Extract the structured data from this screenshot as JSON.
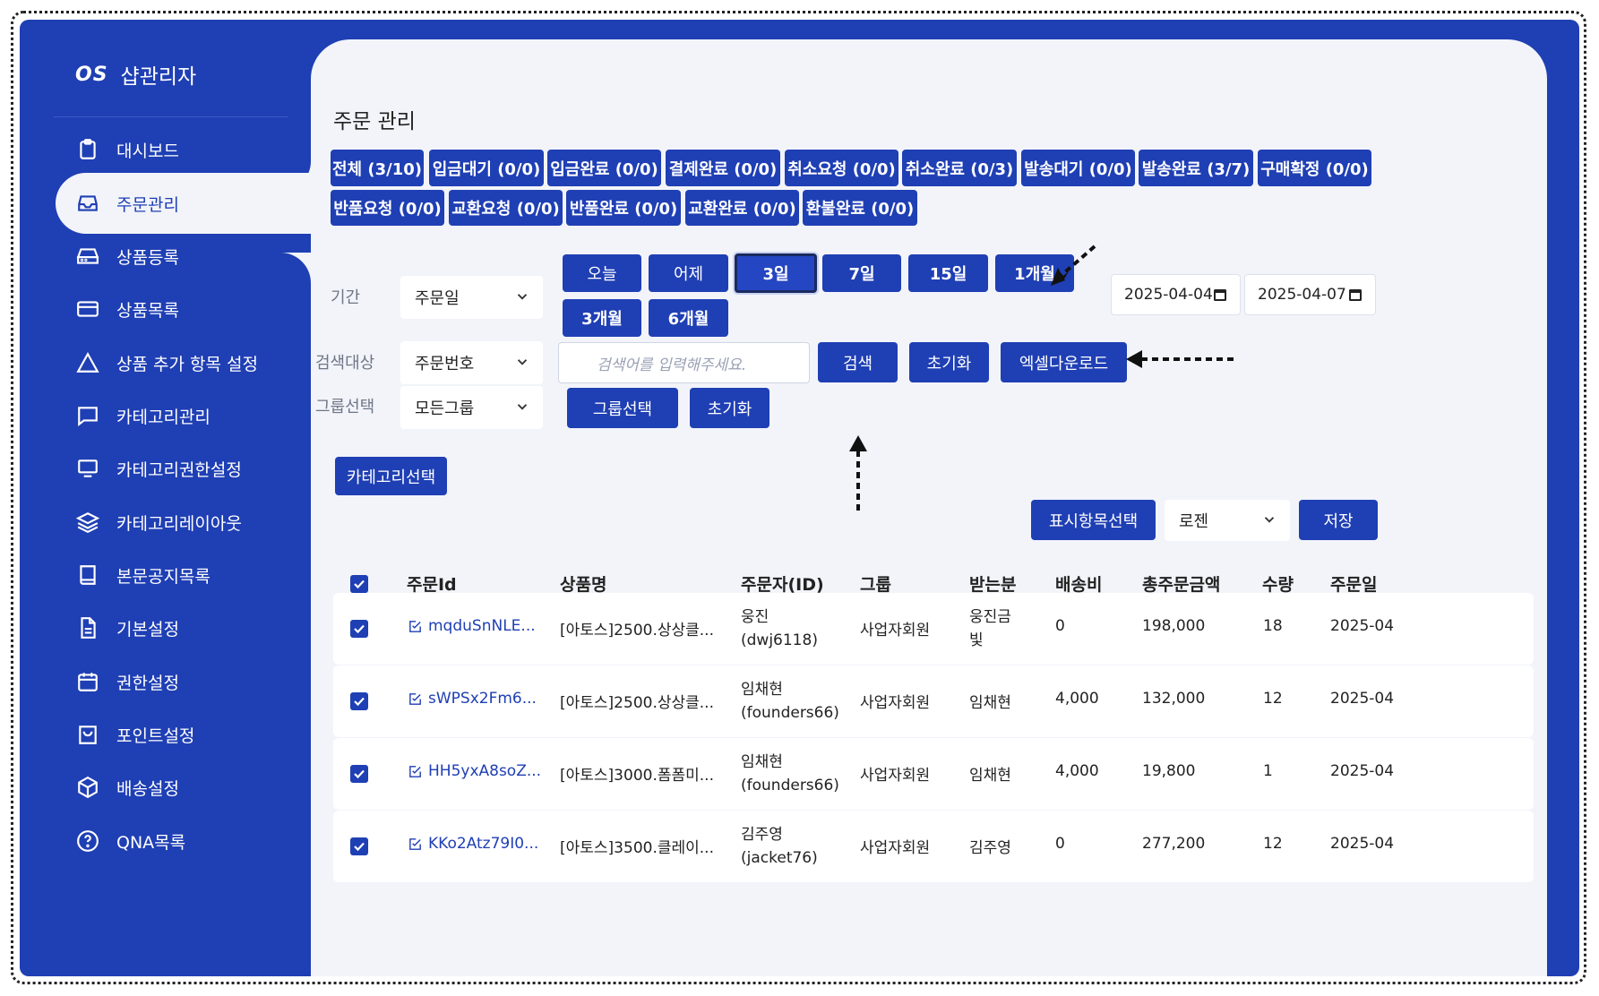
{
  "brand": {
    "logo": "OS",
    "name": "샵관리자"
  },
  "sidebar": {
    "items": [
      {
        "label": "대시보드",
        "icon": "clipboard-icon"
      },
      {
        "label": "주문관리",
        "icon": "inbox-icon",
        "active": true
      },
      {
        "label": "상품등록",
        "icon": "hard-drive-icon"
      },
      {
        "label": "상품목록",
        "icon": "credit-card-icon"
      },
      {
        "label": "상품 추가 항목 설정",
        "icon": "triangle-icon"
      },
      {
        "label": "카테고리관리",
        "icon": "message-square-icon"
      },
      {
        "label": "카테고리권한설정",
        "icon": "monitor-icon"
      },
      {
        "label": "카테고리레이아웃",
        "icon": "layers-icon"
      },
      {
        "label": "본문공지목록",
        "icon": "book-icon"
      },
      {
        "label": "기본설정",
        "icon": "file-text-icon"
      },
      {
        "label": "권한설정",
        "icon": "calendar-icon"
      },
      {
        "label": "포인트설정",
        "icon": "shopping-bag-icon"
      },
      {
        "label": "배송설정",
        "icon": "package-icon"
      },
      {
        "label": "QNA목록",
        "icon": "help-circle-icon"
      }
    ]
  },
  "main": {
    "title": "주문 관리",
    "status_tabs": [
      "전체 (3/10)",
      "입금대기 (0/0)",
      "입금완료 (0/0)",
      "결제완료 (0/0)",
      "취소요청 (0/0)",
      "취소완료 (0/3)",
      "발송대기 (0/0)",
      "발송완료 (3/7)",
      "구매확정 (0/0)",
      "반품요청 (0/0)",
      "교환요청 (0/0)",
      "반품완료 (0/0)",
      "교환완료 (0/0)",
      "환불완료 (0/0)"
    ],
    "filters": {
      "period_label": "기간",
      "period_select": "주문일",
      "period_buttons": [
        "오늘",
        "어제",
        "3일",
        "7일",
        "15일",
        "1개월",
        "3개월",
        "6개월"
      ],
      "period_selected": "3일",
      "date_from": "2025-04-04",
      "date_to": "2025-04-07",
      "search_target_label": "검색대상",
      "search_target_select": "주문번호",
      "search_placeholder": "검색어를 입력해주세요.",
      "search_button": "검색",
      "reset_button": "초기화",
      "excel_button": "엑셀다운로드",
      "group_label": "그룹선택",
      "group_select": "모든그룹",
      "group_select_button": "그룹선택",
      "group_reset_button": "초기화",
      "category_button": "카테고리선택"
    },
    "display": {
      "columns_button": "표시항목선택",
      "courier_select": "로젠",
      "save_button": "저장"
    },
    "table": {
      "headers": [
        "주문Id",
        "상품명",
        "주문자(ID)",
        "그룹",
        "받는분",
        "배송비",
        "총주문금액",
        "수량",
        "주문일"
      ],
      "rows": [
        {
          "order_id": "mqduSnNLE...",
          "product": "[아토스]2500.상상클...",
          "orderer_name": "웅진",
          "orderer_id": "(dwj6118)",
          "group": "사업자회원",
          "recipient_1": "웅진금",
          "recipient_2": "빛",
          "shipping": "0",
          "total": "198,000",
          "qty": "18",
          "date": "2025-04"
        },
        {
          "order_id": "sWPSx2Fm6...",
          "product": "[아토스]2500.상상클...",
          "orderer_name": "임채현",
          "orderer_id": "(founders66)",
          "group": "사업자회원",
          "recipient_1": "임채현",
          "recipient_2": "",
          "shipping": "4,000",
          "total": "132,000",
          "qty": "12",
          "date": "2025-04"
        },
        {
          "order_id": "HH5yxA8soZ...",
          "product": "[아토스]3000.폼폼미...",
          "orderer_name": "임채현",
          "orderer_id": "(founders66)",
          "group": "사업자회원",
          "recipient_1": "임채현",
          "recipient_2": "",
          "shipping": "4,000",
          "total": "19,800",
          "qty": "1",
          "date": "2025-04"
        },
        {
          "order_id": "KKo2Atz79I0...",
          "product": "[아토스]3500.클레이...",
          "orderer_name": "김주영",
          "orderer_id": "(jacket76)",
          "group": "사업자회원",
          "recipient_1": "김주영",
          "recipient_2": "",
          "shipping": "0",
          "total": "277,200",
          "qty": "12",
          "date": "2025-04"
        }
      ]
    }
  },
  "colors": {
    "primary": "#1f3fb4",
    "background": "#f2f4f9"
  }
}
